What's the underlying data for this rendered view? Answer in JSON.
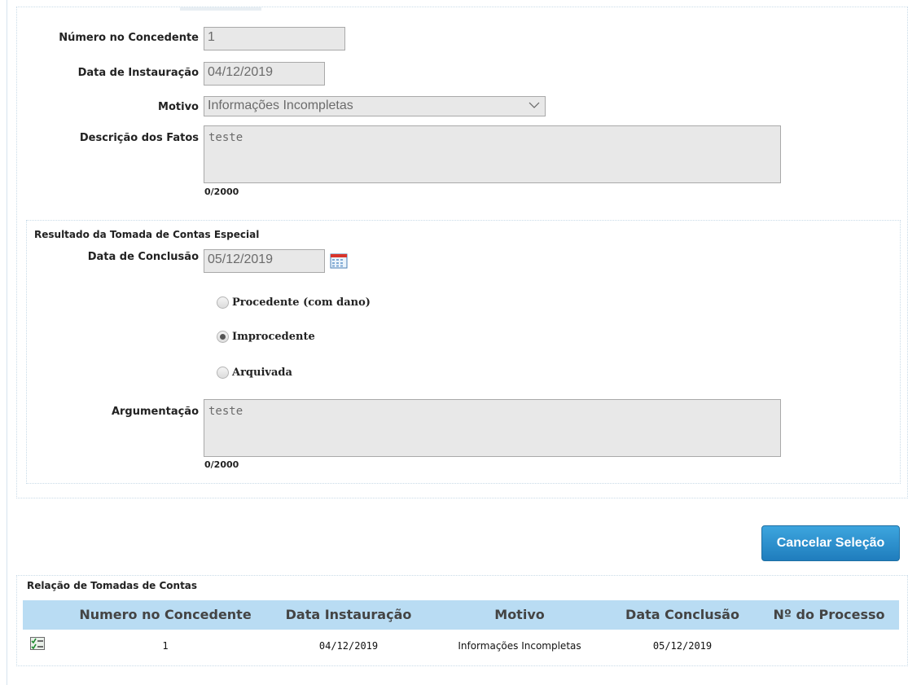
{
  "form": {
    "numero_label": "Número no Concedente",
    "numero_value": "1",
    "data_inst_label": "Data de Instauração",
    "data_inst_value": "04/12/2019",
    "motivo_label": "Motivo",
    "motivo_value": "Informações Incompletas",
    "descricao_label": "Descrição dos Fatos",
    "descricao_value": "teste",
    "descricao_counter": "0/2000"
  },
  "resultado": {
    "title": "Resultado da Tomada de Contas Especial",
    "data_conclusao_label": "Data de Conclusão",
    "data_conclusao_value": "05/12/2019",
    "options": [
      {
        "label": "Procedente (com dano)",
        "selected": false
      },
      {
        "label": "Improcedente",
        "selected": true
      },
      {
        "label": "Arquivada",
        "selected": false
      }
    ],
    "argumentacao_label": "Argumentação",
    "argumentacao_value": "teste",
    "argumentacao_counter": "0/2000"
  },
  "actions": {
    "cancel_label": "Cancelar Seleção"
  },
  "list": {
    "title": "Relação de Tomadas de Contas",
    "columns": [
      "Numero no Concedente",
      "Data Instauração",
      "Motivo",
      "Data Conclusão",
      "Nº do Processo"
    ],
    "rows": [
      {
        "numero": "1",
        "data_instauracao": "04/12/2019",
        "motivo": "Informações Incompletas",
        "data_conclusao": "05/12/2019",
        "processo": ""
      }
    ]
  },
  "colors": {
    "accent": "#1f7dbd",
    "table_header": "#b9dcf3",
    "field_bg": "#e8e8e8"
  },
  "icons": {
    "calendar": "calendar-icon",
    "select_row": "select-row-icon",
    "dropdown": "chevron-down-icon"
  }
}
